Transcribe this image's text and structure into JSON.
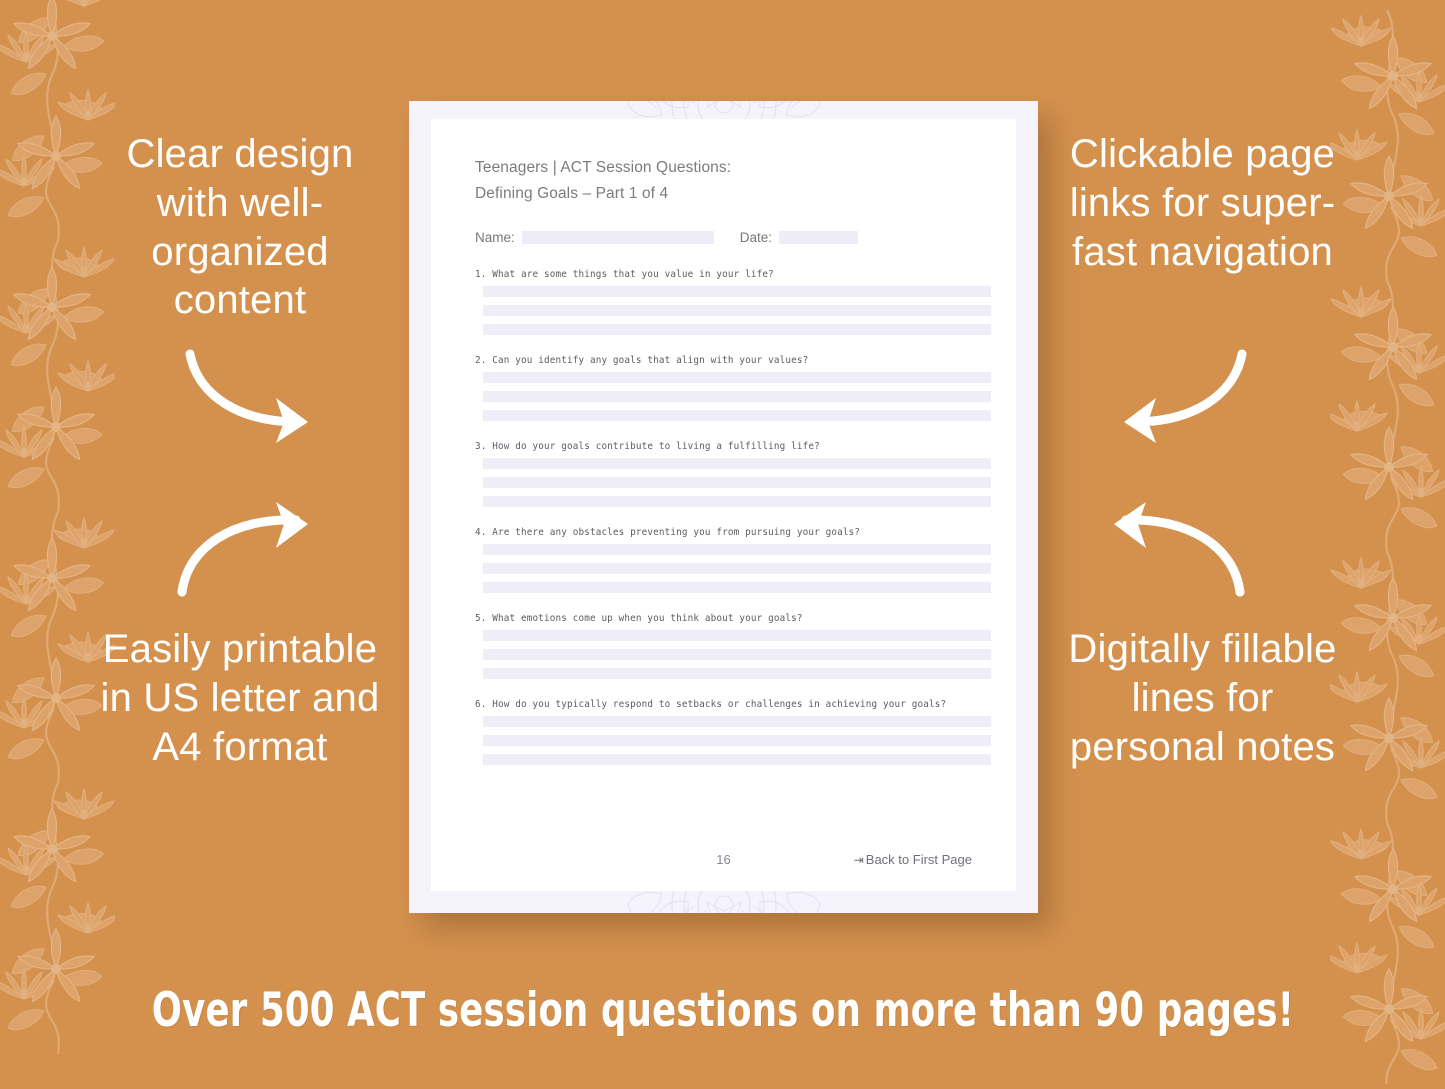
{
  "theme": {
    "background_color": "#d4914e",
    "page_border_color": "#f5f3fb",
    "page_color": "#ffffff",
    "answer_line_color": "#efedf7",
    "promo_text_color": "#ffffff"
  },
  "promos": {
    "top_left": "Clear design with well-organized content",
    "bottom_left": "Easily printable in US letter and A4 format",
    "top_right": "Clickable page links for super-fast navigation",
    "bottom_right": "Digitally fillable lines for personal notes"
  },
  "document": {
    "title_line_1": "Teenagers | ACT Session Questions:",
    "title_line_2": "Defining Goals – Part 1 of 4",
    "name_label": "Name:",
    "date_label": "Date:",
    "questions": [
      "1. What are some things that you value in your life?",
      "2. Can you identify any goals that align with your values?",
      "3. How do your goals contribute to living a fulfilling life?",
      "4. Are there any obstacles preventing you from pursuing your goals?",
      "5. What emotions come up when you think about your goals?",
      "6. How do you typically respond to setbacks or challenges in achieving your goals?"
    ],
    "lines_per_question": 3,
    "page_number": "16",
    "back_link_arrow": "⇥",
    "back_link_label": "Back to First Page"
  },
  "banner": {
    "text": "Over 500 ACT session questions on more than 90 pages!"
  },
  "icons": {
    "arrow_top_left": "curved-arrow-right-down-icon",
    "arrow_bottom_left": "curved-arrow-right-up-icon",
    "arrow_top_right": "curved-arrow-left-down-icon",
    "arrow_bottom_right": "curved-arrow-left-up-icon",
    "floral_border": "floral-vine-icon",
    "mandala_watermark": "mandala-watermark-icon"
  }
}
